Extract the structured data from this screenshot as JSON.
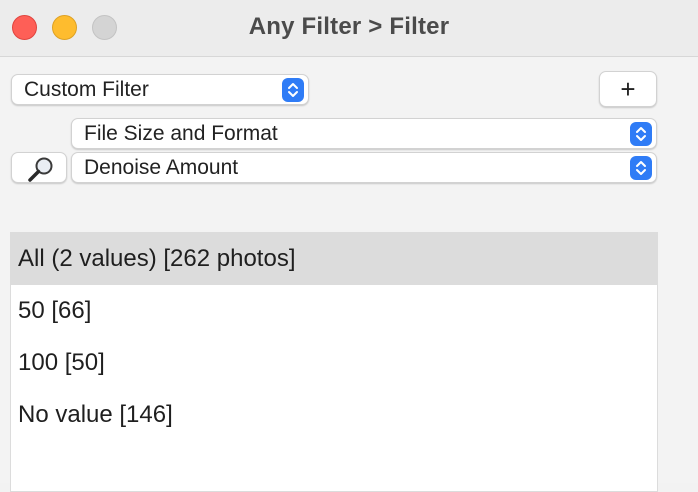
{
  "window": {
    "title": "Any Filter > Filter"
  },
  "controls": {
    "filter_preset": "Custom Filter",
    "add_button_label": "+",
    "category_select": "File Size and Format",
    "field_select": "Denoise Amount"
  },
  "values_list": {
    "rows": [
      "All (2 values) [262 photos]",
      "50 [66]",
      "100 [50]",
      "No value [146]"
    ],
    "selected_index": 0
  },
  "icons": {
    "search": "magnifying-glass-icon",
    "stepper": "up-down-chevron-icon"
  },
  "colors": {
    "accent": "#2f7cf6",
    "close": "#fe5f57",
    "minimize": "#febc2e",
    "zoom_inactive": "#d4d4d4",
    "selected_row": "#dcdcdc"
  }
}
